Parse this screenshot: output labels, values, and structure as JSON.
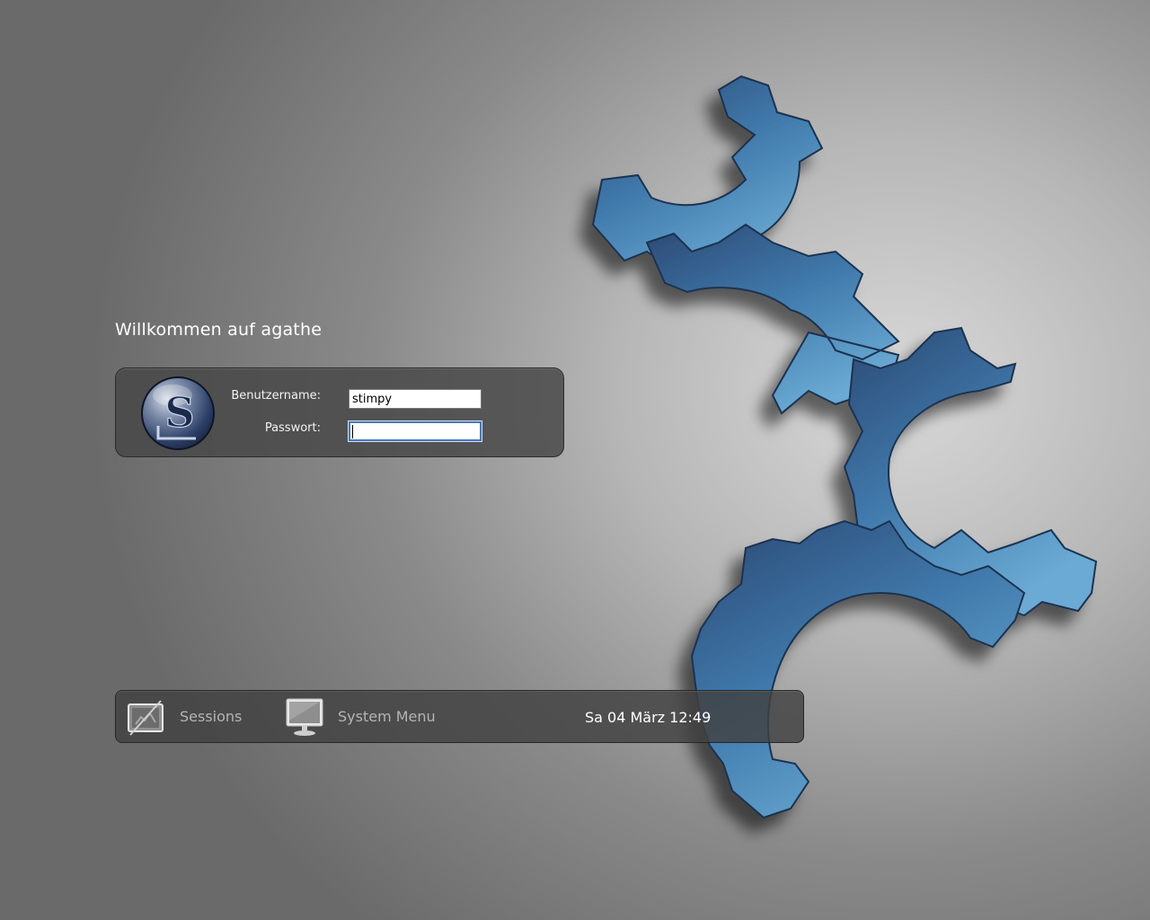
{
  "greeting": "Willkommen auf agathe",
  "login": {
    "username_label": "Benutzername:",
    "username_value": "stimpy",
    "password_label": "Passwort:",
    "password_value": ""
  },
  "bottom_bar": {
    "sessions_label": "Sessions",
    "system_menu_label": "System Menu",
    "clock": "Sa 04 März 12:49"
  },
  "icons": {
    "logo": "slackware-logo",
    "sessions": "sessions-icon",
    "system_menu": "monitor-icon",
    "background": "gears-wallpaper"
  },
  "colors": {
    "panel": "#464646",
    "focus_border": "#4a78b8",
    "gear_dark": "#2c4a78",
    "gear_light": "#5d9fc9"
  }
}
